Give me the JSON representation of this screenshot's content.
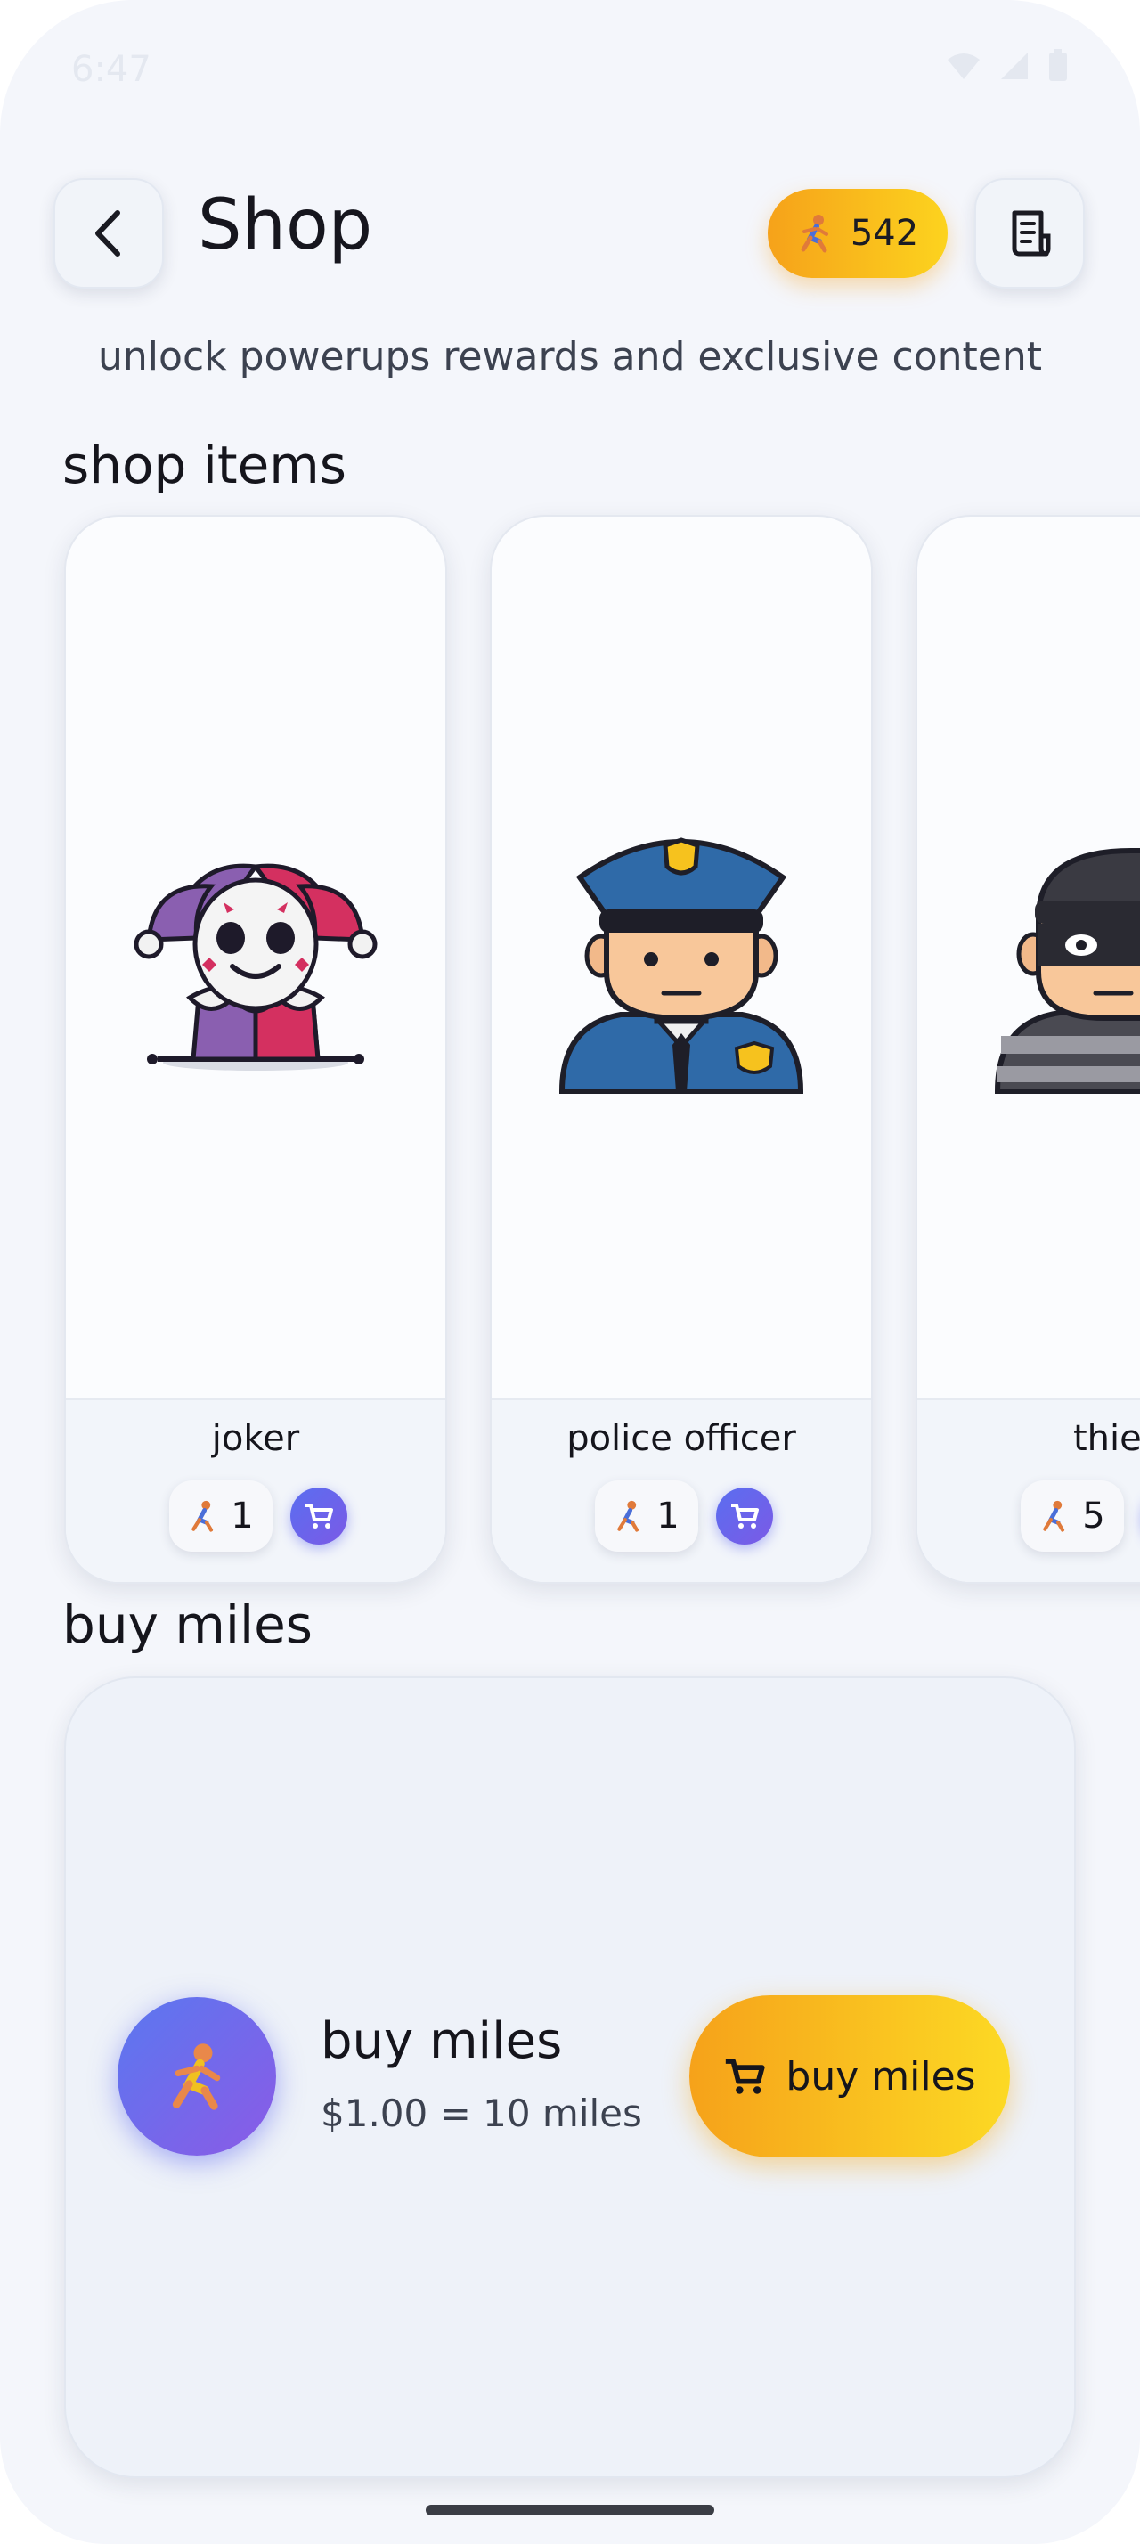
{
  "header": {
    "title": "Shop",
    "coin_balance": "542",
    "back_icon": "chevron-left-icon",
    "history_icon": "receipt-icon"
  },
  "subtitle": "unlock powerups rewards and exclusive content",
  "shop_section": {
    "title": "shop items",
    "items": [
      {
        "name": "joker",
        "price": "1",
        "icon": "jester-avatar"
      },
      {
        "name": "police officer",
        "price": "1",
        "icon": "police-avatar"
      },
      {
        "name": "thief",
        "price": "5",
        "icon": "thief-avatar"
      }
    ]
  },
  "miles_section": {
    "title": "buy miles",
    "card_title": "buy miles",
    "rate": "$1.00 = 10 miles",
    "button_label": "buy miles"
  },
  "colors": {
    "accent_gold_start": "#f6a21a",
    "accent_gold_end": "#fcd31e",
    "cart_purple": "#6366f1",
    "background": "#f4f6fb"
  }
}
